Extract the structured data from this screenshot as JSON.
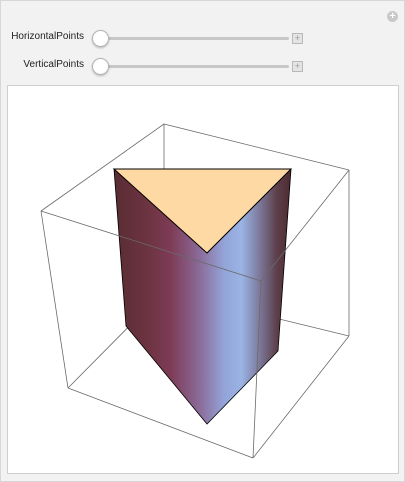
{
  "controls": {
    "horizontal_label": "HorizontalPoints",
    "vertical_label": "VerticalPoints",
    "horizontal_value_fraction": 0,
    "vertical_value_fraction": 0,
    "expand_symbol": "+",
    "corner_symbol": "+"
  },
  "icons": {
    "corner": "plus-circle-icon",
    "expand": "plus-square-icon"
  },
  "colors": {
    "background": "#f2f2f2",
    "panel": "#ffffff",
    "top_face": "#ffd9a3",
    "side_dark": "#5c2f34",
    "side_mid": "#7b3e52",
    "side_light": "#9fb3e6",
    "box_lines": "#555555"
  }
}
